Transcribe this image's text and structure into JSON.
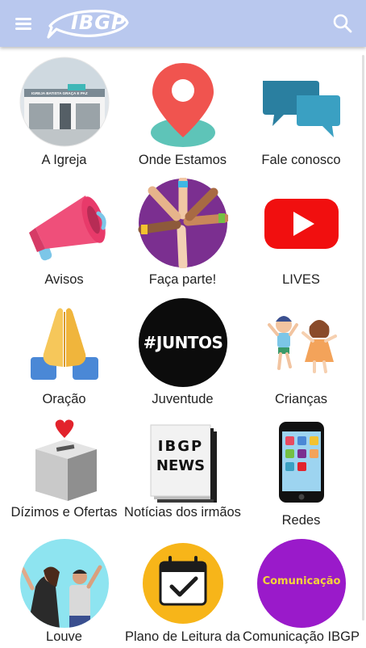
{
  "header": {
    "logo_text": "IBGP",
    "menu_icon": "hamburger-menu-icon",
    "search_icon": "search-icon",
    "bar_color": "#b9c8ee"
  },
  "tiles": [
    {
      "label": "A Igreja",
      "icon": "church-building-icon",
      "sign_text": "IGREJA BATISTA GRAÇA E PAZ"
    },
    {
      "label": "Onde Estamos",
      "icon": "map-pin-icon"
    },
    {
      "label": "Fale conosco",
      "icon": "chat-bubbles-icon"
    },
    {
      "label": "Avisos",
      "icon": "megaphone-icon"
    },
    {
      "label": "Faça parte!",
      "icon": "joined-hands-icon"
    },
    {
      "label": "LIVES",
      "icon": "youtube-play-icon"
    },
    {
      "label": "Oração",
      "icon": "praying-hands-icon"
    },
    {
      "label": "Juventude",
      "icon": "juntos-badge-icon",
      "badge_text": "#JUNTOS"
    },
    {
      "label": "Crianças",
      "icon": "children-playing-icon"
    },
    {
      "label": "Dízimos e Ofertas",
      "icon": "donation-box-icon"
    },
    {
      "label": "Notícias dos irmãos",
      "icon": "newspaper-icon",
      "badge_text_1": "IBGP",
      "badge_text_2": "NEWS"
    },
    {
      "label": "Redes",
      "icon": "smartphone-apps-icon"
    },
    {
      "label": "Louve",
      "icon": "worship-people-icon"
    },
    {
      "label": "Plano de Leitura da",
      "icon": "calendar-check-icon"
    },
    {
      "label": "Comunicação IBGP",
      "icon": "comunicacao-badge-icon",
      "badge_text": "Comunicação"
    }
  ]
}
